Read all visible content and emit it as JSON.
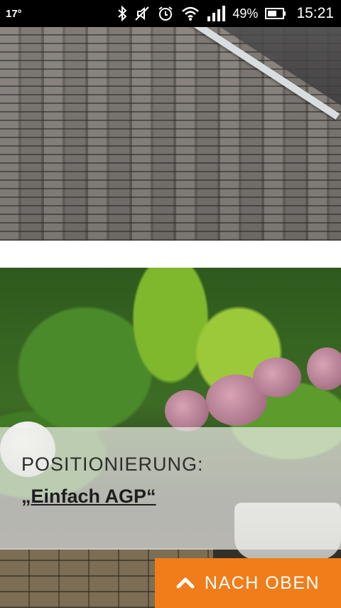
{
  "status_bar": {
    "temperature": "17°",
    "battery_percent": "49%",
    "time": "15:21",
    "icons": [
      "bluetooth-icon",
      "mute-icon",
      "alarm-icon",
      "wifi-icon",
      "signal-icon",
      "battery-icon"
    ]
  },
  "hero": {
    "top_image": "brick-wall-photo",
    "garden_image": "garden-hydrangea-photo"
  },
  "caption": {
    "heading": "POSITIONIERUNG:",
    "link": "„Einfach AGP“"
  },
  "back_to_top": {
    "label": "NACH OBEN",
    "icon": "chevron-up-icon",
    "color": "#f07d1a"
  }
}
